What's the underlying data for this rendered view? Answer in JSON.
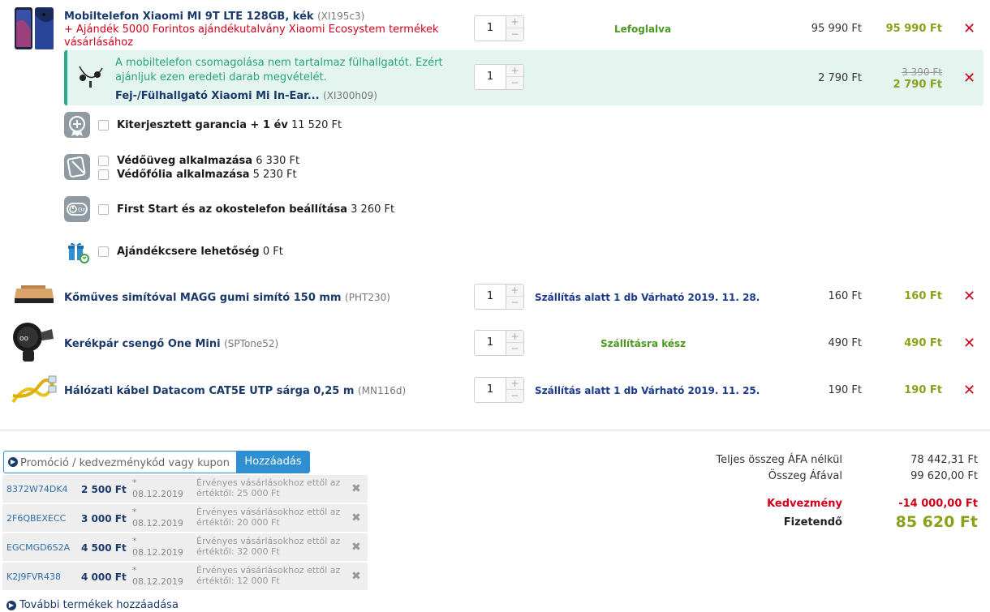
{
  "items": [
    {
      "name": "Mobiltelefon Xiaomi MI 9T LTE 128GB, kék",
      "code": "(XI195c3)",
      "gift": "+ Ajándék 5000 Forintos ajándékutalvány Xiaomi Ecosystem termékek vásárlásához",
      "qty": "1",
      "status": "Lefoglalva",
      "price": "95 990 Ft",
      "total": "95 990 Ft"
    },
    {
      "name": "Kőműves simítóval MAGG gumi simító 150 mm",
      "code": "(PHT230)",
      "qty": "1",
      "status": "Szállítás alatt 1 db Várható 2019. 11. 28.",
      "price": "160 Ft",
      "total": "160 Ft"
    },
    {
      "name": "Kerékpár csengő One Mini",
      "code": "(SPTone52)",
      "qty": "1",
      "status": "Szállításra kész",
      "price": "490 Ft",
      "total": "490 Ft"
    },
    {
      "name": "Hálózati kábel Datacom CAT5E UTP sárga 0,25 m",
      "code": "(MN116d)",
      "qty": "1",
      "status": "Szállítás alatt 1 db Várható 2019. 11. 25.",
      "price": "190 Ft",
      "total": "190 Ft"
    }
  ],
  "suggestion": {
    "text": "A mobiltelefon csomagolása nem tartalmaz fülhallgatót. Ezért ajánljuk ezen eredeti darab megvételét.",
    "name": "Fej-/Fülhallgató Xiaomi Mi In-Ear...",
    "code": "(XI300h09)",
    "qty": "1",
    "price": "2 790 Ft",
    "old_price": "3 390 Ft",
    "total": "2 790 Ft"
  },
  "services": [
    {
      "label": "Kiterjesztett garancia + 1 év",
      "price": "11 520 Ft"
    },
    {
      "label": "Védőüveg alkalmazása",
      "price": "6 330 Ft"
    },
    {
      "label": "Védőfólia alkalmazása",
      "price": "5 230 Ft"
    },
    {
      "label": "First Start és az okostelefon beállítása",
      "price": "3 260 Ft"
    },
    {
      "label": "Ajándékcsere lehetőség",
      "price": "0 Ft"
    }
  ],
  "promo": {
    "placeholder": "Promóció / kedvezménykód vagy kupon",
    "button": "Hozzáadás"
  },
  "coupons": [
    {
      "code": "8372W74DK4",
      "amount": "2 500 Ft",
      "star": "*",
      "date": "08.12.2019",
      "valid": "Érvényes vásárlásokhoz ettől az értéktől: 25 000 Ft"
    },
    {
      "code": "2F6QBEXECC",
      "amount": "3 000 Ft",
      "star": "*",
      "date": "08.12.2019",
      "valid": "Érvényes vásárlásokhoz ettől az értéktől: 20 000 Ft"
    },
    {
      "code": "EGCMGD6S2A",
      "amount": "4 500 Ft",
      "star": "*",
      "date": "08.12.2019",
      "valid": "Érvényes vásárlásokhoz ettől az értéktől: 32 000 Ft"
    },
    {
      "code": "K2J9FVR438",
      "amount": "4 000 Ft",
      "star": "*",
      "date": "08.12.2019",
      "valid": "Érvényes vásárlásokhoz ettől az értéktől: 12 000 Ft"
    }
  ],
  "more_link": "További termékek hozzáadása",
  "summary": {
    "net_label": "Teljes összeg ÁFA nélkül",
    "net_value": "78 442,31 Ft",
    "gross_label": "Összeg Áfával",
    "gross_value": "99 620,00 Ft",
    "discount_label": "Kedvezmény",
    "discount_value": "-14 000,00 Ft",
    "pay_label": "Fizetendő",
    "pay_value": "85 620 Ft"
  },
  "colors": {
    "accent_blue": "#2f8fd0",
    "price_green": "#8aa11a",
    "remove_red": "#d0021b",
    "suggest_bg": "#e4f5ef"
  }
}
